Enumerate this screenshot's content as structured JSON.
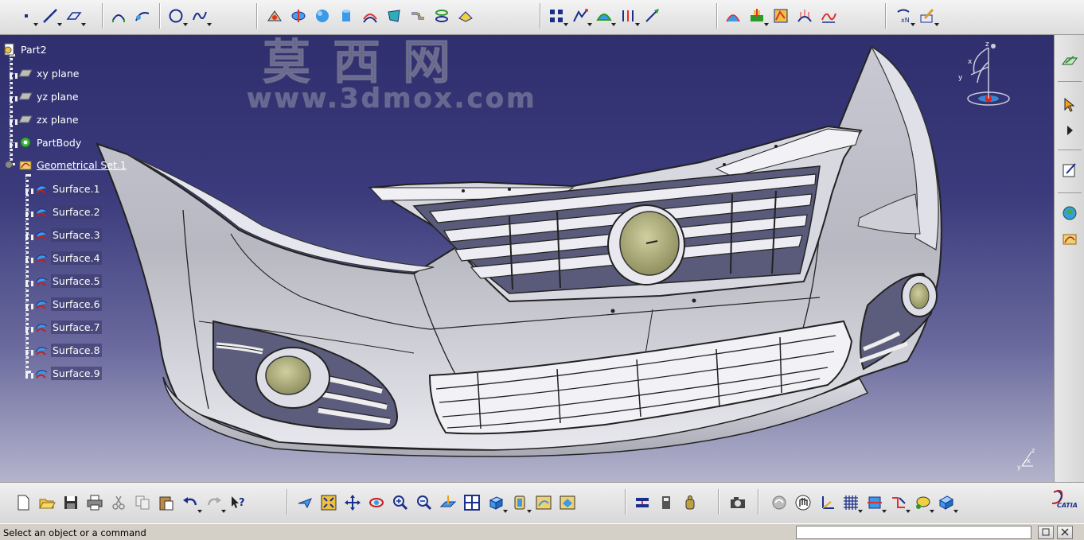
{
  "app": {
    "name": "CATIA",
    "logo_text": "CATIA"
  },
  "watermark": {
    "cn": "莫西网",
    "url": "www.3dmox.com"
  },
  "spec_tree": {
    "root": "Part2",
    "planes": [
      "xy plane",
      "yz plane",
      "zx plane"
    ],
    "body": "PartBody",
    "geometrical_set": "Geometrical Set.1",
    "surfaces": [
      "Surface.1",
      "Surface.2",
      "Surface.3",
      "Surface.4",
      "Surface.5",
      "Surface.6",
      "Surface.7",
      "Surface.8",
      "Surface.9"
    ]
  },
  "compass_axes": {
    "z": "z",
    "x": "x",
    "y": "y"
  },
  "mini_axes": {
    "z": "z",
    "x": "x",
    "y": "y"
  },
  "status": {
    "message": "Select an object or a command",
    "command_input": ""
  },
  "top_toolbar_icons": [
    "point-icon",
    "line-icon",
    "plane-icon",
    "extrude-surface-icon",
    "sweep-surface-icon",
    "circle-icon",
    "spline-icon",
    "join-icon",
    "split-icon",
    "sphere-icon",
    "cylinder-icon",
    "offset-icon",
    "fill-icon",
    "blend-icon",
    "multisection-icon",
    "extract-icon",
    "pattern-icon",
    "transform-icon",
    "boundary-icon",
    "translate-icon",
    "extrapolate-icon",
    "draft-analysis-icon",
    "curvature-analysis-icon",
    "connect-checker-icon",
    "porcupine-icon",
    "distance-analysis-icon",
    "axis-system-icon",
    "sketcher-icon"
  ],
  "bottom_toolbar_icons": [
    "new-icon",
    "open-icon",
    "save-icon",
    "print-icon",
    "cut-icon",
    "copy-icon",
    "paste-icon",
    "undo-icon",
    "redo-icon",
    "whats-this-icon",
    "fly-mode-icon",
    "fit-all-icon",
    "pan-icon",
    "rotate-icon",
    "zoom-in-icon",
    "zoom-out-icon",
    "normal-view-icon",
    "multi-view-icon",
    "iso-view-icon",
    "shading-icon",
    "hide-show-icon",
    "swap-visible-icon",
    "measure-between-icon",
    "measure-item-icon",
    "mass-icon",
    "capture-icon",
    "update-icon",
    "snap-icon",
    "axis-icon",
    "grid-icon",
    "work-plane-icon",
    "constraint-icon",
    "apply-material-icon",
    "catalog-icon"
  ],
  "right_toolbar_icons": [
    "sketch-icon",
    "select-icon",
    "expand-icon",
    "edit-sketch-icon",
    "knowledge-icon",
    "geometrical-set-icon"
  ]
}
